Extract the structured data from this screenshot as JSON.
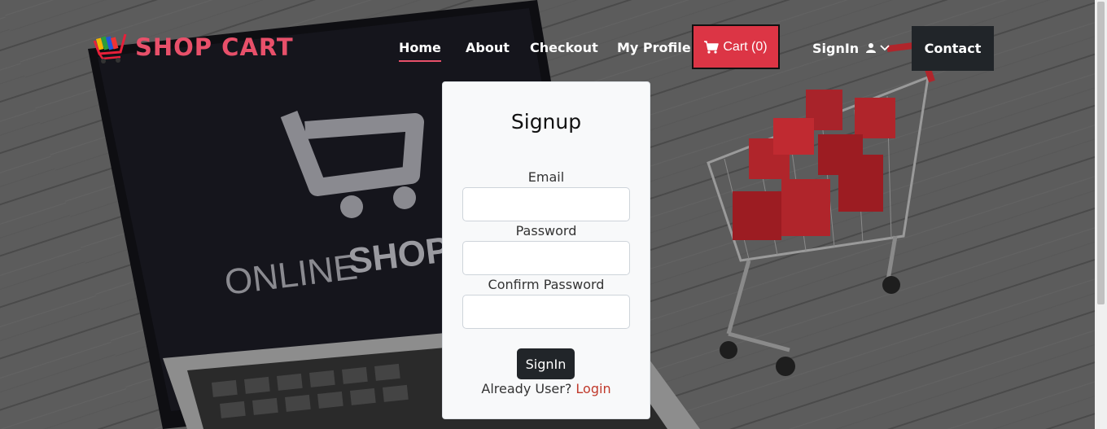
{
  "brand": {
    "name": "SHOP CART",
    "logo_icon": "shopping-cart-logo-icon",
    "color": "#e8506a"
  },
  "nav": {
    "home": "Home",
    "about": "About",
    "checkout": "Checkout",
    "my_profile": "My Profile",
    "cart_label": "Cart (0)",
    "cart_icon": "shopping-cart-icon",
    "signin_label": "SignIn",
    "signin_icons": [
      "user-icon",
      "chevron-down-icon"
    ],
    "contact": "Contact",
    "active_item": "Home",
    "accent_color": "#dc3545"
  },
  "background": {
    "laptop_text_light": "ONLINE",
    "laptop_text_bold": "SHOP"
  },
  "form": {
    "title": "Signup",
    "email_label": "Email",
    "email_value": "",
    "password_label": "Password",
    "password_value": "",
    "confirm_label": "Confirm Password",
    "confirm_value": "",
    "submit_label": "SignIn",
    "already_text": "Already User?",
    "login_link": "Login"
  }
}
